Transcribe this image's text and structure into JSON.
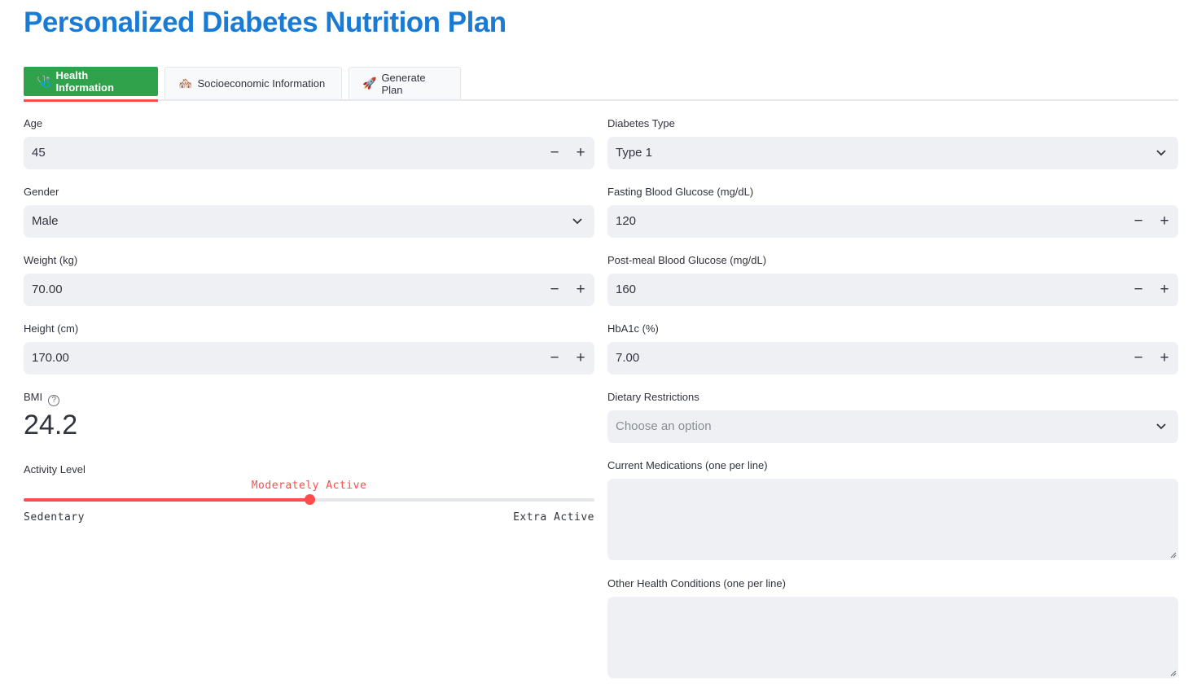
{
  "title": "Personalized Diabetes Nutrition Plan",
  "tabs": [
    {
      "label": "Health Information",
      "icon": "🩺"
    },
    {
      "label": "Socioeconomic Information",
      "icon": "🏘️"
    },
    {
      "label": "Generate Plan",
      "icon": "🚀"
    }
  ],
  "left": {
    "age": {
      "label": "Age",
      "value": "45"
    },
    "gender": {
      "label": "Gender",
      "value": "Male"
    },
    "weight": {
      "label": "Weight (kg)",
      "value": "70.00"
    },
    "height": {
      "label": "Height (cm)",
      "value": "170.00"
    },
    "bmi": {
      "label": "BMI",
      "help": "?",
      "value": "24.2"
    },
    "activity": {
      "label": "Activity Level",
      "value": "Moderately Active",
      "min_label": "Sedentary",
      "max_label": "Extra Active",
      "fraction": 0.5
    }
  },
  "right": {
    "diabetes_type": {
      "label": "Diabetes Type",
      "value": "Type 1"
    },
    "fasting": {
      "label": "Fasting Blood Glucose (mg/dL)",
      "value": "120"
    },
    "postmeal": {
      "label": "Post-meal Blood Glucose (mg/dL)",
      "value": "160"
    },
    "hba1c": {
      "label": "HbA1c (%)",
      "value": "7.00"
    },
    "restrictions": {
      "label": "Dietary Restrictions",
      "placeholder": "Choose an option"
    },
    "medications": {
      "label": "Current Medications (one per line)",
      "value": ""
    },
    "conditions": {
      "label": "Other Health Conditions (one per line)",
      "value": ""
    }
  },
  "stepper": {
    "minus": "−",
    "plus": "+"
  },
  "colors": {
    "title": "#1a7bd4",
    "accent": "#ff4b4b",
    "active_tab": "#31a24c",
    "field_bg": "#eef0f4"
  }
}
